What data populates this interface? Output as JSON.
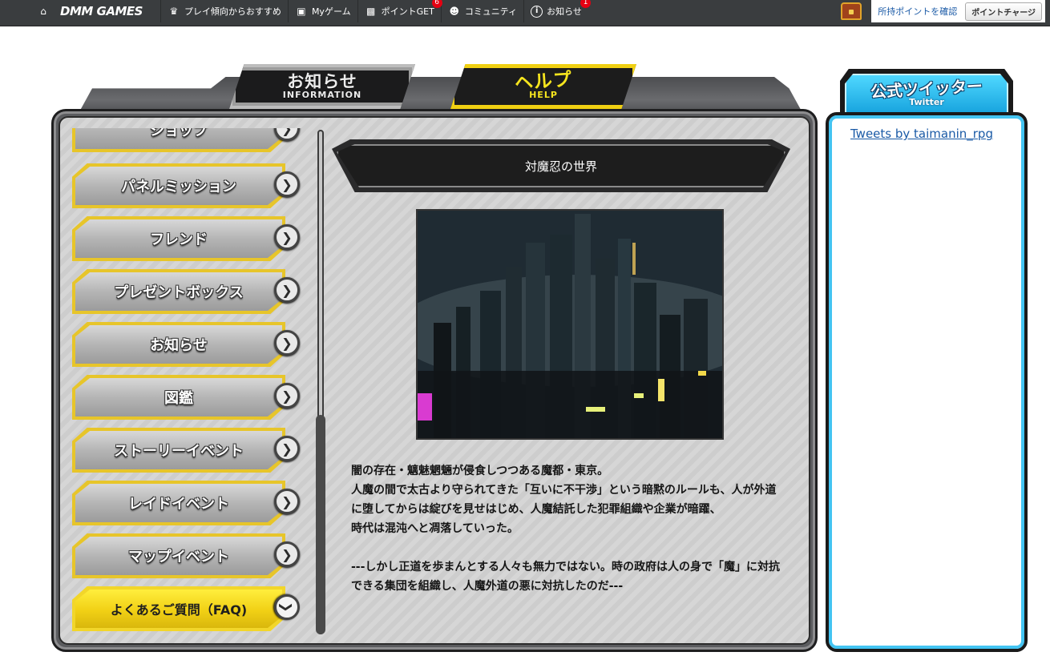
{
  "topbar": {
    "brand": "DMM GAMES",
    "nav": [
      {
        "label": "プレイ傾向からおすすめ",
        "icon": "crown-icon"
      },
      {
        "label": "Myゲーム",
        "icon": "gamepad-icon"
      },
      {
        "label": "ポイントGET",
        "icon": "gift-icon",
        "badge": "6"
      },
      {
        "label": "コミュニティ",
        "icon": "people-icon"
      },
      {
        "label": "お知らせ",
        "icon": "info-icon",
        "badge": "1"
      }
    ],
    "points_link": "所持ポイントを確認",
    "charge_button": "ポイントチャージ"
  },
  "tabs": {
    "info": {
      "main": "お知らせ",
      "sub": "INFORMATION"
    },
    "help": {
      "main": "ヘルプ",
      "sub": "HELP"
    }
  },
  "menu": {
    "items": [
      {
        "label": "ショップ"
      },
      {
        "label": "パネルミッション"
      },
      {
        "label": "フレンド"
      },
      {
        "label": "プレゼントボックス"
      },
      {
        "label": "お知らせ"
      },
      {
        "label": "図鑑"
      },
      {
        "label": "ストーリーイベント"
      },
      {
        "label": "レイドイベント"
      },
      {
        "label": "マップイベント"
      },
      {
        "label": "よくあるご質問（FAQ)",
        "active": true
      }
    ]
  },
  "content": {
    "title": "対魔忍の世界",
    "paragraphs": [
      "闇の存在・魑魅魍魎が侵食しつつある魔都・東京。",
      "人魔の間で太古より守られてきた「互いに不干渉」という暗黙のルールも、人が外道に堕してからは綻びを見せはじめ、人魔結託した犯罪組織や企業が暗躍、",
      "時代は混沌へと凋落していった。",
      "",
      "---しかし正道を歩まんとする人々も無力ではない。時の政府は人の身で「魔」に対抗できる集団を組織し、人魔外道の悪に対抗したのだ---"
    ]
  },
  "twitter": {
    "header_main": "公式ツイッター",
    "header_sub": "Twitter",
    "link": "Tweets by taimanin_rpg"
  },
  "colors": {
    "topbar": "#3a3d3f",
    "accent_yellow": "#f2d62a",
    "twitter_blue": "#43c4f2",
    "badge_red": "#e60012"
  }
}
